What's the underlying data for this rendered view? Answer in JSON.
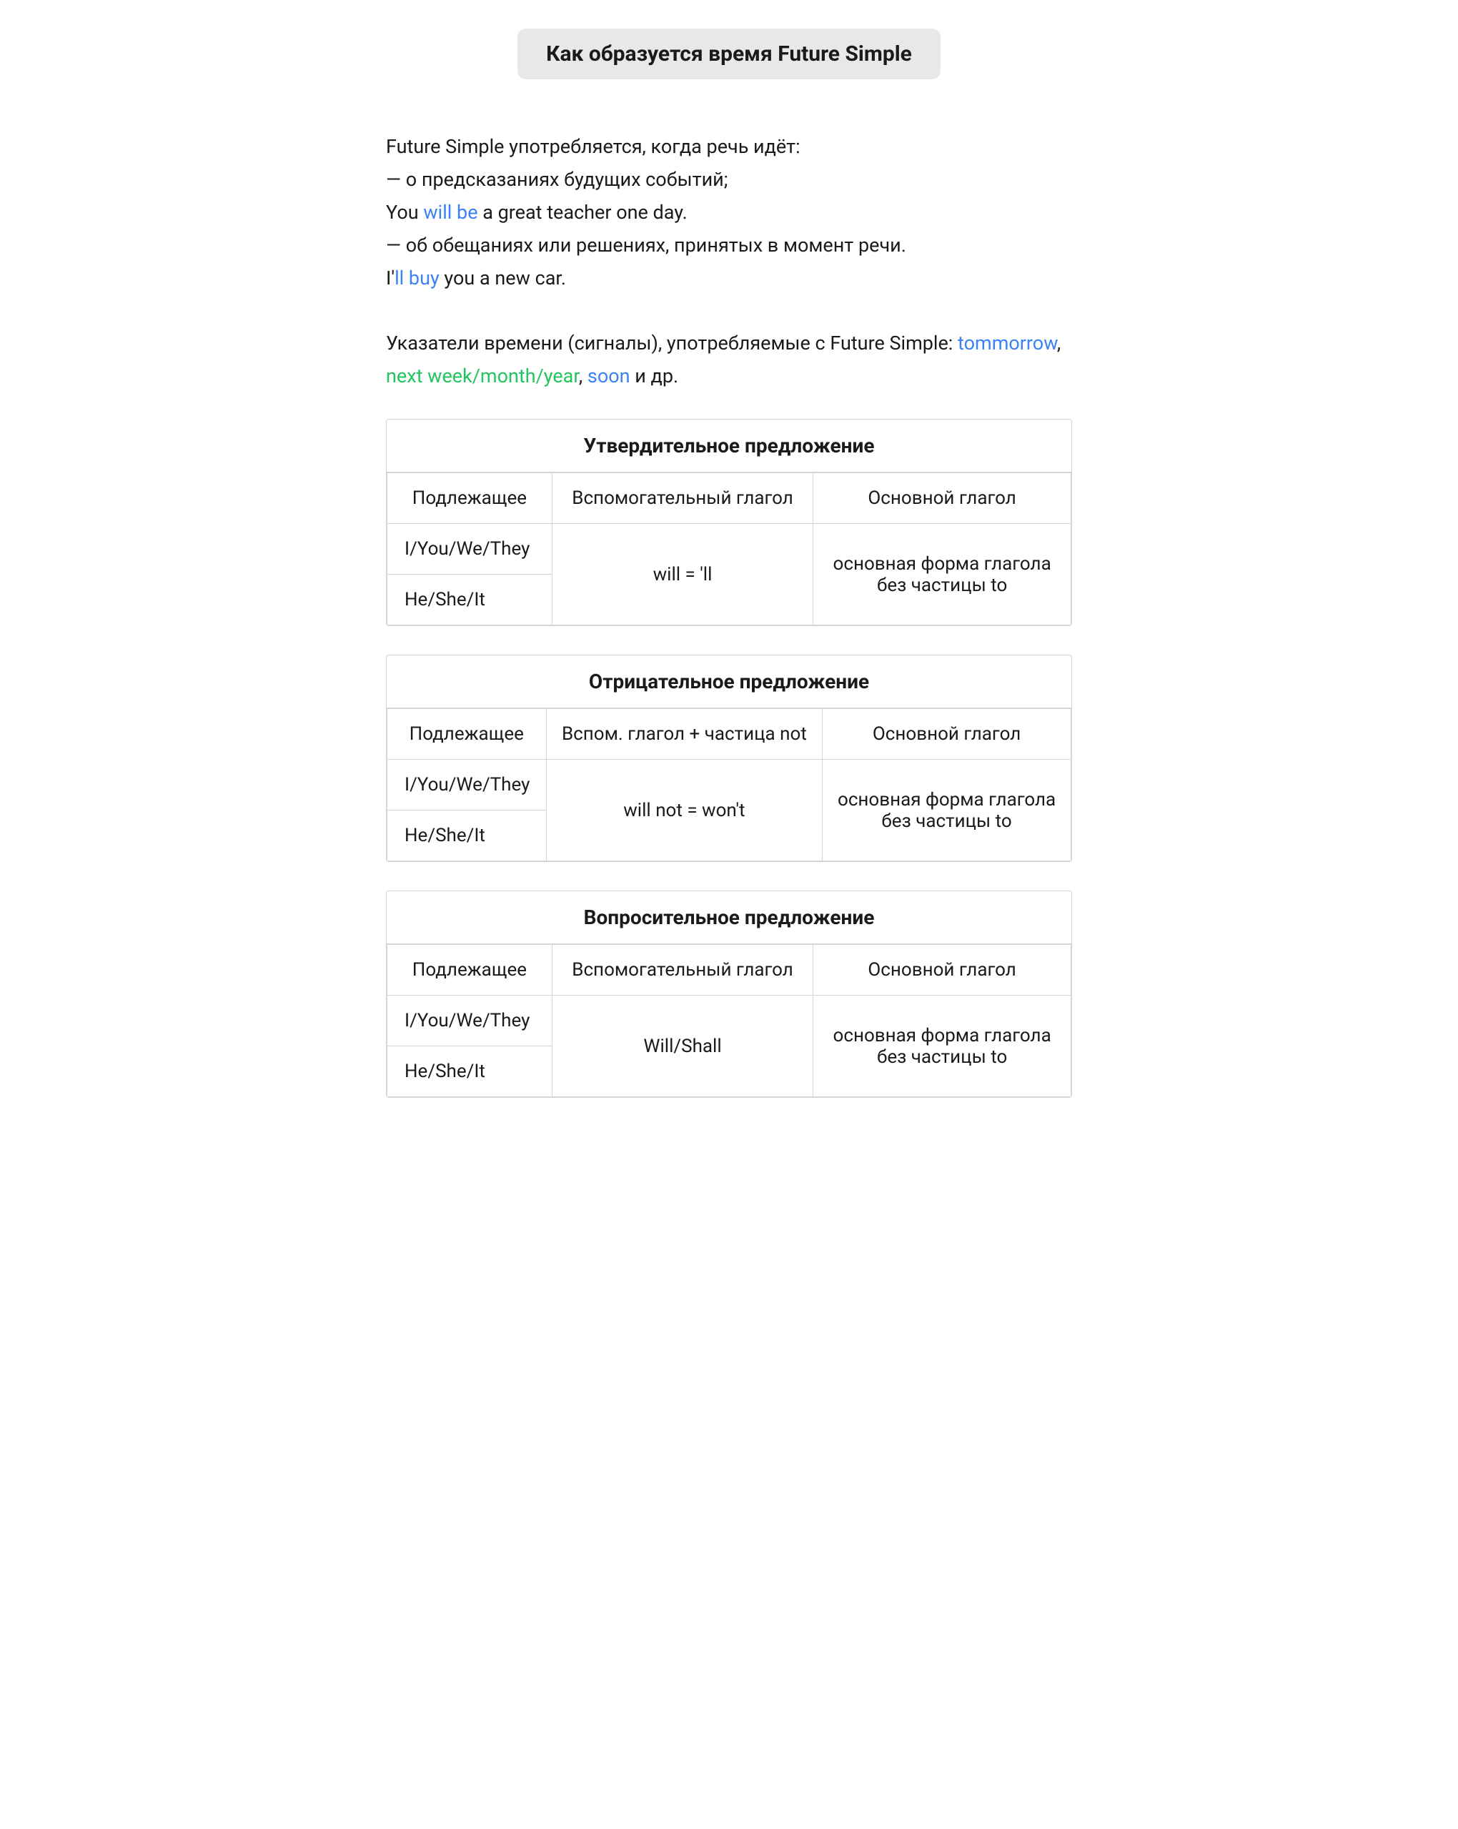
{
  "page": {
    "title": "Как образуется время Future Simple",
    "intro": {
      "line1": "Future Simple употребляется, когда речь идёт:",
      "line2": "— о предсказаниях будущих событий;",
      "line3_pre": "You ",
      "line3_highlight": "will be",
      "line3_post": " a great teacher one day.",
      "line4": "— об обещаниях или решениях, принятых в момент речи.",
      "line5_pre": "I'",
      "line5_highlight": "ll buy",
      "line5_post": " you a new car.",
      "line6_pre": "Указатели времени (сигналы), употребляемые с Future Simple: ",
      "line6_h1": "tommorrow",
      "line6_sep1": ", ",
      "line6_h2": "next week",
      "line6_sep2": "/",
      "line6_h3": "month",
      "line6_sep3": "/",
      "line6_h4": "year",
      "line6_sep4": ", ",
      "line6_h5": "soon",
      "line6_post": " и др."
    },
    "affirmative": {
      "section_title": "Утвердительное предложение",
      "col1": "Подлежащее",
      "col2": "Вспомогательный глагол",
      "col3": "Основной глагол",
      "subject1": "I/You/We/They",
      "subject2": "He/She/It",
      "aux_verb": "will = 'll",
      "main_verb_line1": "основная форма глагола",
      "main_verb_line2": "без частицы to"
    },
    "negative": {
      "section_title": "Отрицательное предложение",
      "col1": "Подлежащее",
      "col2": "Вспом. глагол + частица not",
      "col3": "Основной глагол",
      "subject1": "I/You/We/They",
      "subject2": "He/She/It",
      "aux_verb": "will not = won't",
      "main_verb_line1": "основная форма глагола",
      "main_verb_line2": "без частицы to"
    },
    "question": {
      "section_title": "Вопросительное предложение",
      "col1": "Подлежащее",
      "col2": "Вспомогательный глагол",
      "col3": "Основной глагол",
      "subject1": "I/You/We/They",
      "subject2": "He/She/It",
      "aux_verb": "Will/Shall",
      "main_verb_line1": "основная форма глагола",
      "main_verb_line2": "без частицы to"
    }
  }
}
